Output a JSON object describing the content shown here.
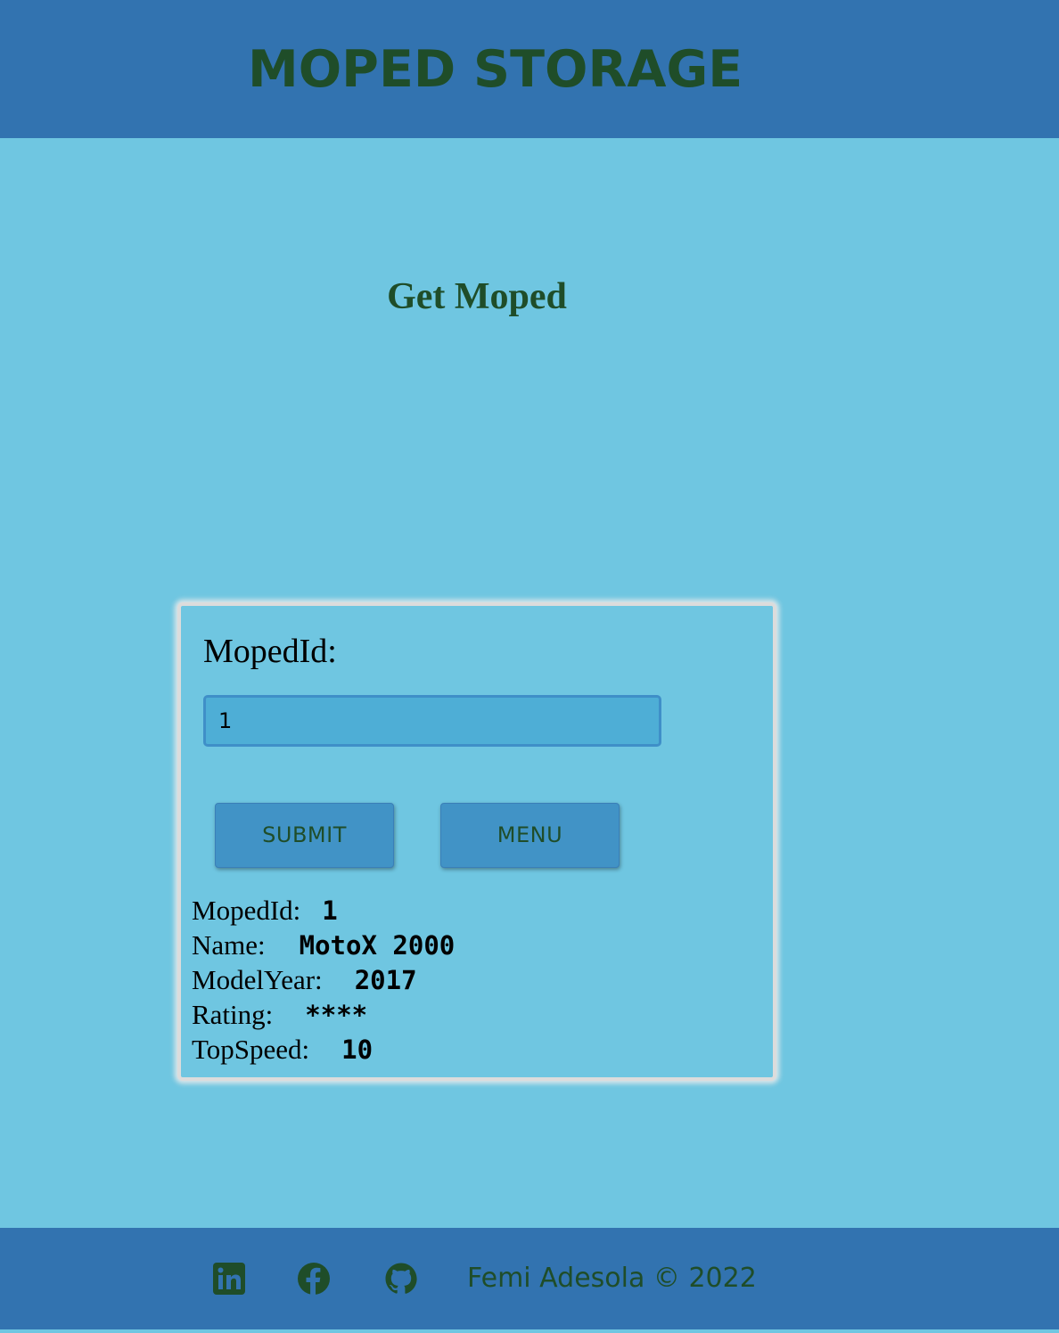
{
  "header": {
    "title": "MOPED STORAGE"
  },
  "main": {
    "heading": "Get Moped"
  },
  "form": {
    "field_label": "MopedId:",
    "input_value": "1",
    "submit_label": "SUBMIT",
    "menu_label": "MENU"
  },
  "result": {
    "rows": [
      {
        "label": "MopedId:",
        "value": "1"
      },
      {
        "label": "Name:",
        "value": "MotoX 2000"
      },
      {
        "label": "ModelYear:",
        "value": "2017"
      },
      {
        "label": "Rating:",
        "value": "****"
      },
      {
        "label": "TopSpeed:",
        "value": "10"
      }
    ]
  },
  "footer": {
    "icons": [
      "linkedin-icon",
      "facebook-icon",
      "github-icon"
    ],
    "copyright": "Femi Adesola © 2022"
  },
  "colors": {
    "header_bg": "#3273b0",
    "page_bg": "#6fc6e1",
    "title_text": "#1f4d29",
    "button_bg": "#4193c6",
    "input_bg": "#4eaed6"
  }
}
